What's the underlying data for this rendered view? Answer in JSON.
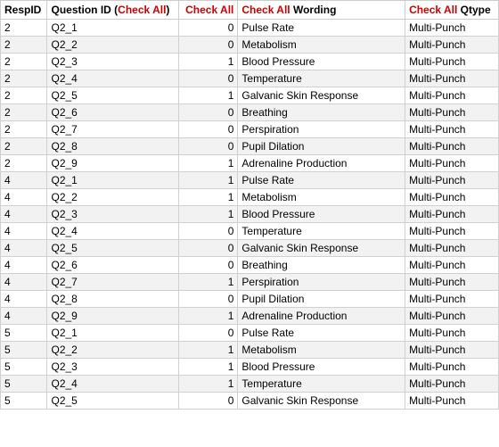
{
  "table": {
    "headers": [
      {
        "label": "RespID",
        "class": "col-respid"
      },
      {
        "label": "Question ID (Check All)",
        "class": "col-qid",
        "highlight": "Check All"
      },
      {
        "label": "Check All",
        "class": "col-checkall",
        "highlight": "Check All"
      },
      {
        "label": "Check All Wording",
        "class": "col-wording",
        "highlight": "Check All"
      },
      {
        "label": "Qtype",
        "class": "col-qtype"
      }
    ],
    "rows": [
      {
        "respid": 2,
        "qid": "Q2_1",
        "checkall": 0,
        "wording": "Pulse Rate",
        "qtype": "Multi-Punch"
      },
      {
        "respid": 2,
        "qid": "Q2_2",
        "checkall": 0,
        "wording": "Metabolism",
        "qtype": "Multi-Punch"
      },
      {
        "respid": 2,
        "qid": "Q2_3",
        "checkall": 1,
        "wording": "Blood Pressure",
        "qtype": "Multi-Punch"
      },
      {
        "respid": 2,
        "qid": "Q2_4",
        "checkall": 0,
        "wording": "Temperature",
        "qtype": "Multi-Punch"
      },
      {
        "respid": 2,
        "qid": "Q2_5",
        "checkall": 1,
        "wording": "Galvanic Skin Response",
        "qtype": "Multi-Punch"
      },
      {
        "respid": 2,
        "qid": "Q2_6",
        "checkall": 0,
        "wording": "Breathing",
        "qtype": "Multi-Punch"
      },
      {
        "respid": 2,
        "qid": "Q2_7",
        "checkall": 0,
        "wording": "Perspiration",
        "qtype": "Multi-Punch"
      },
      {
        "respid": 2,
        "qid": "Q2_8",
        "checkall": 0,
        "wording": "Pupil Dilation",
        "qtype": "Multi-Punch"
      },
      {
        "respid": 2,
        "qid": "Q2_9",
        "checkall": 1,
        "wording": "Adrenaline Production",
        "qtype": "Multi-Punch"
      },
      {
        "respid": 4,
        "qid": "Q2_1",
        "checkall": 1,
        "wording": "Pulse Rate",
        "qtype": "Multi-Punch"
      },
      {
        "respid": 4,
        "qid": "Q2_2",
        "checkall": 1,
        "wording": "Metabolism",
        "qtype": "Multi-Punch"
      },
      {
        "respid": 4,
        "qid": "Q2_3",
        "checkall": 1,
        "wording": "Blood Pressure",
        "qtype": "Multi-Punch"
      },
      {
        "respid": 4,
        "qid": "Q2_4",
        "checkall": 0,
        "wording": "Temperature",
        "qtype": "Multi-Punch"
      },
      {
        "respid": 4,
        "qid": "Q2_5",
        "checkall": 0,
        "wording": "Galvanic Skin Response",
        "qtype": "Multi-Punch"
      },
      {
        "respid": 4,
        "qid": "Q2_6",
        "checkall": 0,
        "wording": "Breathing",
        "qtype": "Multi-Punch"
      },
      {
        "respid": 4,
        "qid": "Q2_7",
        "checkall": 1,
        "wording": "Perspiration",
        "qtype": "Multi-Punch"
      },
      {
        "respid": 4,
        "qid": "Q2_8",
        "checkall": 0,
        "wording": "Pupil Dilation",
        "qtype": "Multi-Punch"
      },
      {
        "respid": 4,
        "qid": "Q2_9",
        "checkall": 1,
        "wording": "Adrenaline Production",
        "qtype": "Multi-Punch"
      },
      {
        "respid": 5,
        "qid": "Q2_1",
        "checkall": 0,
        "wording": "Pulse Rate",
        "qtype": "Multi-Punch"
      },
      {
        "respid": 5,
        "qid": "Q2_2",
        "checkall": 1,
        "wording": "Metabolism",
        "qtype": "Multi-Punch"
      },
      {
        "respid": 5,
        "qid": "Q2_3",
        "checkall": 1,
        "wording": "Blood Pressure",
        "qtype": "Multi-Punch"
      },
      {
        "respid": 5,
        "qid": "Q2_4",
        "checkall": 1,
        "wording": "Temperature",
        "qtype": "Multi-Punch"
      },
      {
        "respid": 5,
        "qid": "Q2_5",
        "checkall": 0,
        "wording": "Galvanic Skin Response",
        "qtype": "Multi-Punch"
      }
    ]
  }
}
